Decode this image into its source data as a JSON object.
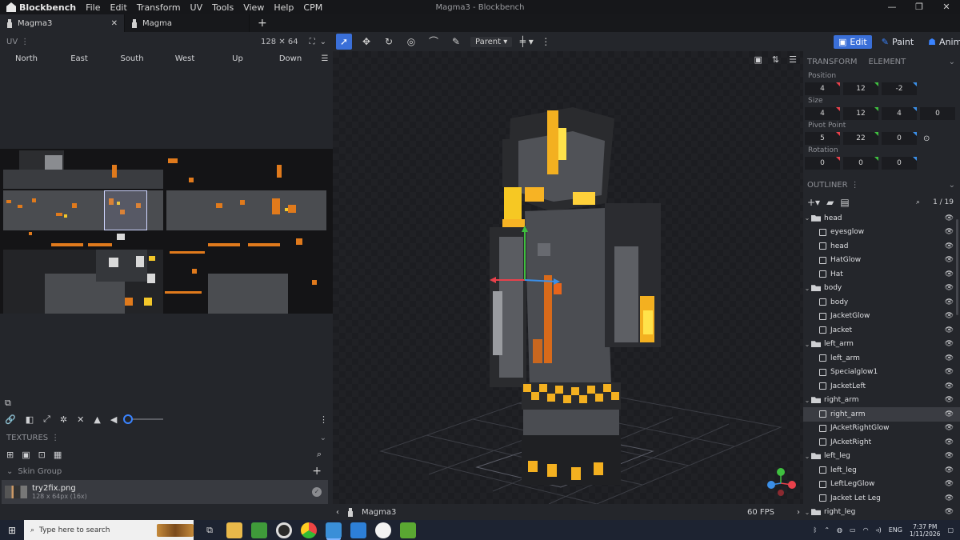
{
  "app": {
    "name": "Blockbench",
    "window_title": "Magma3 - Blockbench",
    "menu": [
      "File",
      "Edit",
      "Transform",
      "UV",
      "Tools",
      "View",
      "Help",
      "CPM"
    ],
    "window_controls": [
      "—",
      "❐",
      "✕"
    ]
  },
  "tabs": [
    {
      "label": "Magma3",
      "active": true
    },
    {
      "label": "Magma",
      "active": false
    }
  ],
  "uv_panel": {
    "title": "UV",
    "resolution": "128 ✕ 64",
    "faces": [
      "North",
      "East",
      "South",
      "West",
      "Up",
      "Down"
    ]
  },
  "textures_panel": {
    "title": "TEXTURES",
    "group_label": "Skin Group",
    "texture": {
      "name": "try2fix.png",
      "info": "128 x 64px (16x)"
    }
  },
  "toolbar": {
    "pivot_mode": "Parent"
  },
  "modes": [
    {
      "label": "Edit",
      "active": true,
      "icon": "cube-icon"
    },
    {
      "label": "Paint",
      "active": false,
      "icon": "brush-icon"
    },
    {
      "label": "Animate",
      "active": false,
      "icon": "runner-icon"
    }
  ],
  "viewport": {
    "model_name": "Magma3",
    "fps": "60 FPS"
  },
  "transform": {
    "tabs": [
      "TRANSFORM",
      "ELEMENT"
    ],
    "position_label": "Position",
    "position": [
      "4",
      "12",
      "-2"
    ],
    "size_label": "Size",
    "size": [
      "4",
      "12",
      "4",
      "0"
    ],
    "pivot_label": "Pivot Point",
    "pivot": [
      "5",
      "22",
      "0"
    ],
    "rotation_label": "Rotation",
    "rotation": [
      "0",
      "0",
      "0"
    ]
  },
  "outliner": {
    "title": "OUTLINER",
    "count": "1 / 19",
    "nodes": [
      {
        "label": "head",
        "type": "group",
        "depth": 0
      },
      {
        "label": "eyesglow",
        "type": "cube",
        "depth": 1
      },
      {
        "label": "head",
        "type": "cube",
        "depth": 1
      },
      {
        "label": "HatGlow",
        "type": "cube",
        "depth": 1
      },
      {
        "label": "Hat",
        "type": "cube",
        "depth": 1
      },
      {
        "label": "body",
        "type": "group",
        "depth": 0
      },
      {
        "label": "body",
        "type": "cube",
        "depth": 1
      },
      {
        "label": "JacketGlow",
        "type": "cube",
        "depth": 1
      },
      {
        "label": "Jacket",
        "type": "cube",
        "depth": 1
      },
      {
        "label": "left_arm",
        "type": "group",
        "depth": 0
      },
      {
        "label": "left_arm",
        "type": "cube",
        "depth": 1
      },
      {
        "label": "Specialglow1",
        "type": "cube",
        "depth": 1
      },
      {
        "label": "JacketLeft",
        "type": "cube",
        "depth": 1
      },
      {
        "label": "right_arm",
        "type": "group",
        "depth": 0
      },
      {
        "label": "right_arm",
        "type": "cube",
        "depth": 1,
        "selected": true
      },
      {
        "label": "JAcketRightGlow",
        "type": "cube",
        "depth": 1
      },
      {
        "label": "JAcketRight",
        "type": "cube",
        "depth": 1
      },
      {
        "label": "left_leg",
        "type": "group",
        "depth": 0
      },
      {
        "label": "left_leg",
        "type": "cube",
        "depth": 1
      },
      {
        "label": "LeftLegGlow",
        "type": "cube",
        "depth": 1
      },
      {
        "label": "Jacket Let Leg",
        "type": "cube",
        "depth": 1
      },
      {
        "label": "right_leg",
        "type": "group",
        "depth": 0
      }
    ]
  },
  "taskbar": {
    "search_placeholder": "Type here to search",
    "language": "ENG",
    "time": "7:37 PM",
    "date": "1/11/2026"
  },
  "colors": {
    "accent": "#3a6fd8",
    "axis_x": "#e8414b",
    "axis_y": "#3fbf3f",
    "axis_z": "#3b8fe8",
    "lava": "#f0a21c"
  }
}
